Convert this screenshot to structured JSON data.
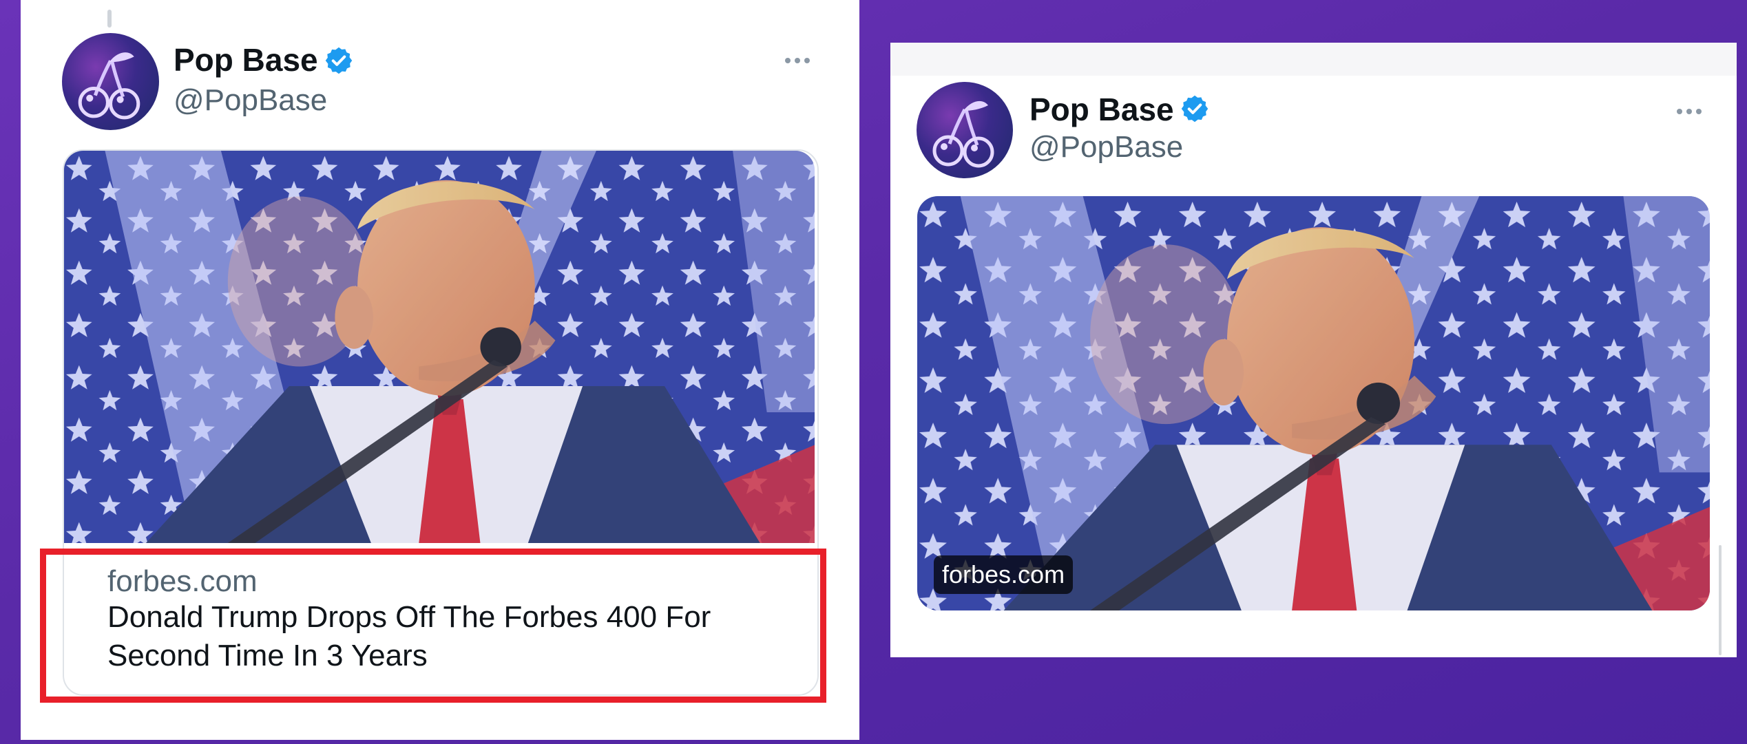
{
  "colors": {
    "background": "#5a2aa8",
    "verified": "#1d9bf0",
    "highlight": "#e8202a",
    "text_primary": "#0f1419",
    "text_secondary": "#536471"
  },
  "left_tweet": {
    "author": {
      "display_name": "Pop Base",
      "handle": "@PopBase",
      "avatar_icon": "cherry-icon",
      "verified_icon": "verified-badge-icon"
    },
    "more_icon": "more-icon",
    "link_card": {
      "domain": "forbes.com",
      "title": "Donald Trump Drops Off The Forbes 400 For Second Time In 3 Years"
    }
  },
  "right_tweet": {
    "author": {
      "display_name": "Pop Base",
      "handle": "@PopBase",
      "avatar_icon": "cherry-icon",
      "verified_icon": "verified-badge-icon"
    },
    "more_icon": "more-icon",
    "link_card": {
      "domain_chip": "forbes.com"
    }
  }
}
